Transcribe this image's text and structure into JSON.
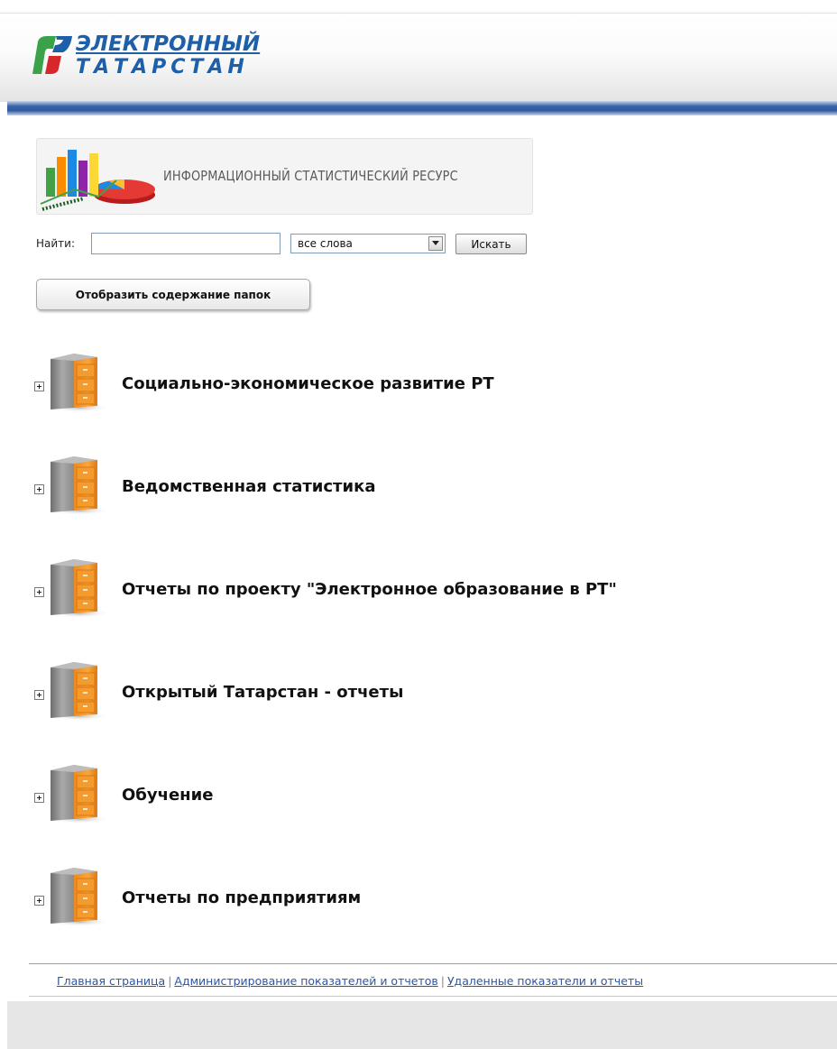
{
  "header": {
    "logo_line1": "ЭЛЕКТРОННЫЙ",
    "logo_line2": "ТАТАРСТАН",
    "brand_colors": {
      "blue": "#1d5fa8",
      "green": "#3aa34a",
      "red": "#d8262d",
      "bar": "#2d58a0"
    }
  },
  "banner": {
    "title": "ИНФОРМАЦИОННЫЙ СТАТИСТИЧЕСКИЙ РЕСУРС"
  },
  "search": {
    "label": "Найти:",
    "input_value": "",
    "mode_selected": "все слова",
    "button_label": "Искать"
  },
  "folders_button": {
    "label": "Отобразить содержание папок"
  },
  "tree": {
    "items": [
      {
        "label": "Социально-экономическое развитие РТ",
        "icon": "file-cabinet-icon"
      },
      {
        "label": "Ведомственная статистика",
        "icon": "file-cabinet-icon"
      },
      {
        "label": "Отчеты по проекту \"Электронное образование в РТ\"",
        "icon": "file-cabinet-icon"
      },
      {
        "label": "Открытый Татарстан - отчеты",
        "icon": "file-cabinet-icon"
      },
      {
        "label": "Обучение",
        "icon": "file-cabinet-icon"
      },
      {
        "label": "Отчеты по предприятиям",
        "icon": "file-cabinet-icon"
      }
    ]
  },
  "footer": {
    "links": [
      {
        "label": "Главная страница"
      },
      {
        "label": "Администрирование показателей и отчетов"
      },
      {
        "label": "Удаленные показатели и отчеты"
      }
    ],
    "separator": "|"
  }
}
